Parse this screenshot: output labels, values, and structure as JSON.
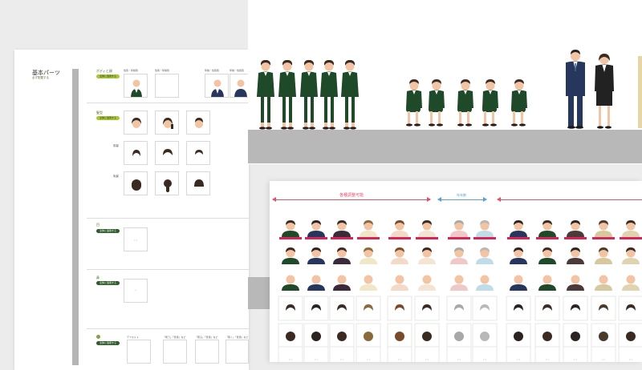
{
  "left_sheet": {
    "title": "基本パーツ",
    "subtitle": "必ず配置する",
    "sections": [
      {
        "name": "ボディと顔",
        "tag": "全体に適用する",
        "cell_labels": [
          "性別・年齢別",
          "性別・年齢別",
          "年齢・性別別",
          "年齢・性別別"
        ]
      },
      {
        "name": "髪型",
        "tag": "全体に適用する",
        "rows": [
          "前髪",
          "後髪"
        ]
      },
      {
        "name": "目",
        "tag": "全体に適用する",
        "placeholder": "× ×"
      },
      {
        "name": "鼻",
        "tag": "全体に適用する",
        "placeholder": "⌒"
      },
      {
        "name": "口",
        "tag": "全体に適用する",
        "cell_labels": [
          "デフォルト",
          "「笑う」「普通」など",
          "「怒る」「普通」など",
          "「驚く」「普通」など",
          "「普通」「普通」など"
        ]
      }
    ]
  },
  "bottom_sheet": {
    "labels": {
      "red_1": "各種調整可能",
      "blue_1": "年年齢"
    },
    "row_placeholder": "× ×"
  },
  "colors": {
    "uniform_green": "#1f4a2a",
    "suit_navy": "#26365c",
    "skin": "#f2c4a4",
    "hair": "#3a2a22",
    "accent_red": "#dd2255",
    "accent_blue": "#5aa0d0",
    "tag_green": "#2f5c2b",
    "tag_lime": "#a8c832"
  }
}
